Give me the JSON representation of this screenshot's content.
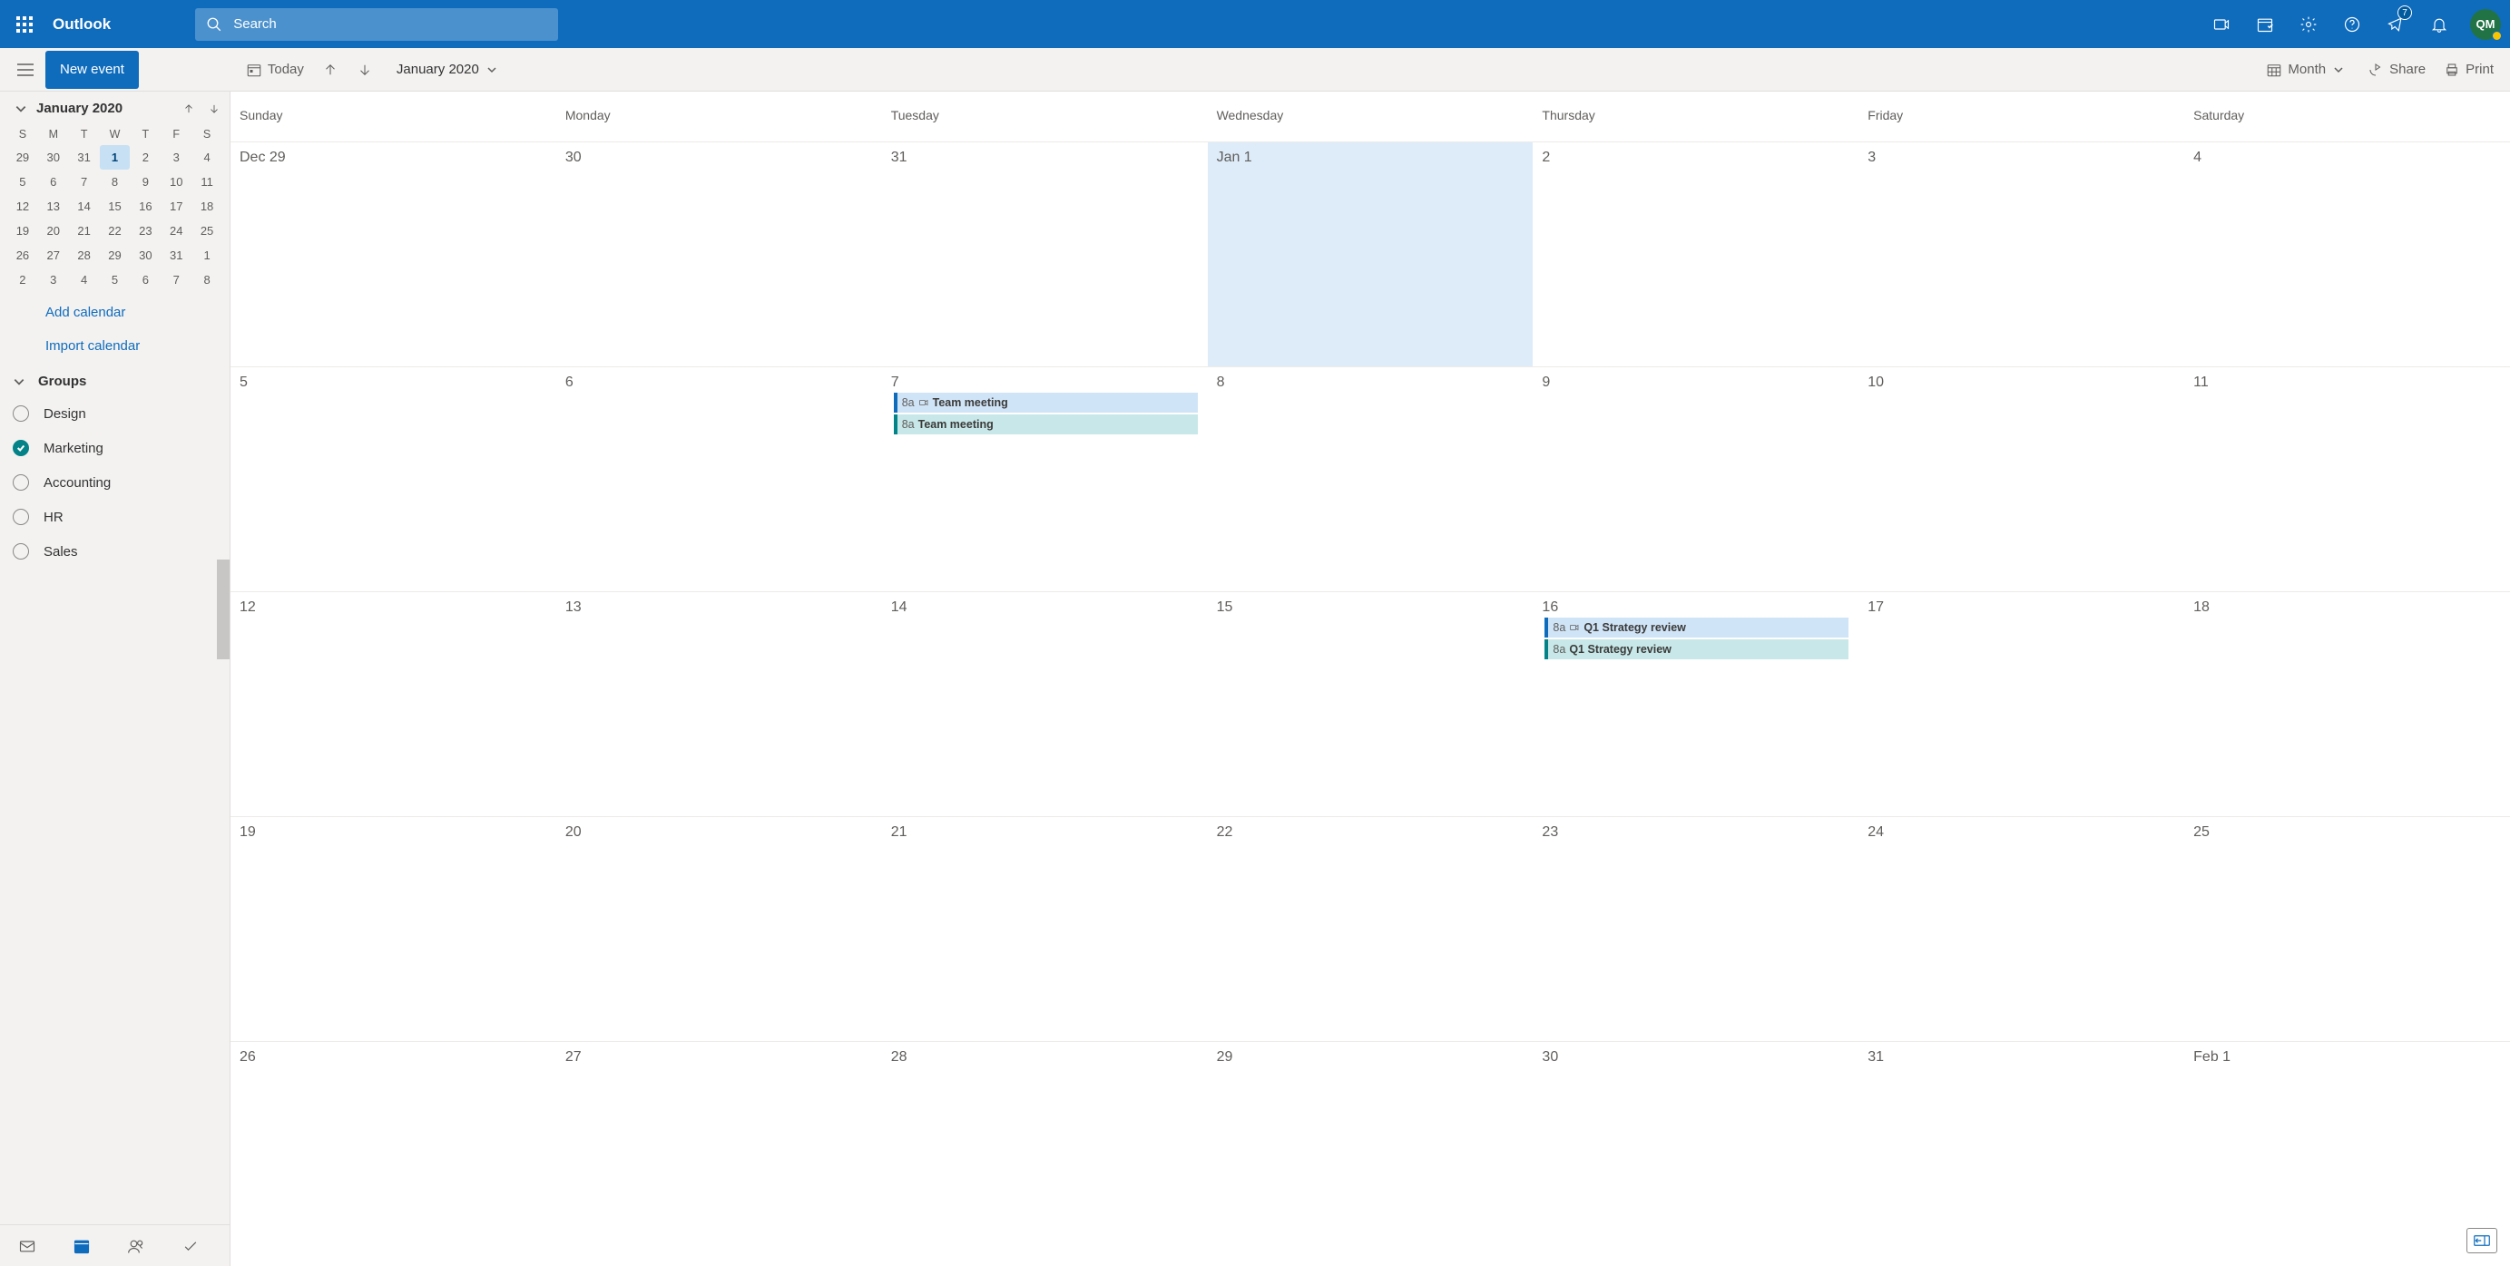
{
  "header": {
    "app_title": "Outlook",
    "search_placeholder": "Search",
    "feedback_badge": "7",
    "avatar_initials": "QM"
  },
  "toolbar": {
    "new_event": "New event",
    "today": "Today",
    "month_label": "January 2020",
    "view_mode": "Month",
    "share": "Share",
    "print": "Print"
  },
  "sidebar": {
    "month_title": "January 2020",
    "dow": [
      "S",
      "M",
      "T",
      "W",
      "T",
      "F",
      "S"
    ],
    "mini_weeks": [
      [
        "29",
        "30",
        "31",
        "1",
        "2",
        "3",
        "4"
      ],
      [
        "5",
        "6",
        "7",
        "8",
        "9",
        "10",
        "11"
      ],
      [
        "12",
        "13",
        "14",
        "15",
        "16",
        "17",
        "18"
      ],
      [
        "19",
        "20",
        "21",
        "22",
        "23",
        "24",
        "25"
      ],
      [
        "26",
        "27",
        "28",
        "29",
        "30",
        "31",
        "1"
      ],
      [
        "2",
        "3",
        "4",
        "5",
        "6",
        "7",
        "8"
      ]
    ],
    "mini_today_index": [
      0,
      3
    ],
    "add_calendar": "Add calendar",
    "import_calendar": "Import calendar",
    "groups_label": "Groups",
    "calendars": [
      {
        "name": "Design",
        "checked": false
      },
      {
        "name": "Marketing",
        "checked": true
      },
      {
        "name": "Accounting",
        "checked": false
      },
      {
        "name": "HR",
        "checked": false
      },
      {
        "name": "Sales",
        "checked": false
      }
    ]
  },
  "calendar": {
    "dow": [
      "Sunday",
      "Monday",
      "Tuesday",
      "Wednesday",
      "Thursday",
      "Friday",
      "Saturday"
    ],
    "today_cell": [
      0,
      3
    ],
    "weeks": [
      [
        {
          "label": "Dec 29"
        },
        {
          "label": "30"
        },
        {
          "label": "31"
        },
        {
          "label": "Jan 1"
        },
        {
          "label": "2"
        },
        {
          "label": "3"
        },
        {
          "label": "4"
        }
      ],
      [
        {
          "label": "5"
        },
        {
          "label": "6"
        },
        {
          "label": "7",
          "events": [
            {
              "time": "8a",
              "title": "Team meeting",
              "style": "blue",
              "online": true
            },
            {
              "time": "8a",
              "title": "Team meeting",
              "style": "teal",
              "online": false
            }
          ]
        },
        {
          "label": "8"
        },
        {
          "label": "9"
        },
        {
          "label": "10"
        },
        {
          "label": "11"
        }
      ],
      [
        {
          "label": "12"
        },
        {
          "label": "13"
        },
        {
          "label": "14"
        },
        {
          "label": "15"
        },
        {
          "label": "16",
          "events": [
            {
              "time": "8a",
              "title": "Q1 Strategy review",
              "style": "blue",
              "online": true
            },
            {
              "time": "8a",
              "title": "Q1 Strategy review",
              "style": "teal",
              "online": false
            }
          ]
        },
        {
          "label": "17"
        },
        {
          "label": "18"
        }
      ],
      [
        {
          "label": "19"
        },
        {
          "label": "20"
        },
        {
          "label": "21"
        },
        {
          "label": "22"
        },
        {
          "label": "23"
        },
        {
          "label": "24"
        },
        {
          "label": "25"
        }
      ],
      [
        {
          "label": "26"
        },
        {
          "label": "27"
        },
        {
          "label": "28"
        },
        {
          "label": "29"
        },
        {
          "label": "30"
        },
        {
          "label": "31"
        },
        {
          "label": "Feb 1"
        }
      ]
    ]
  }
}
